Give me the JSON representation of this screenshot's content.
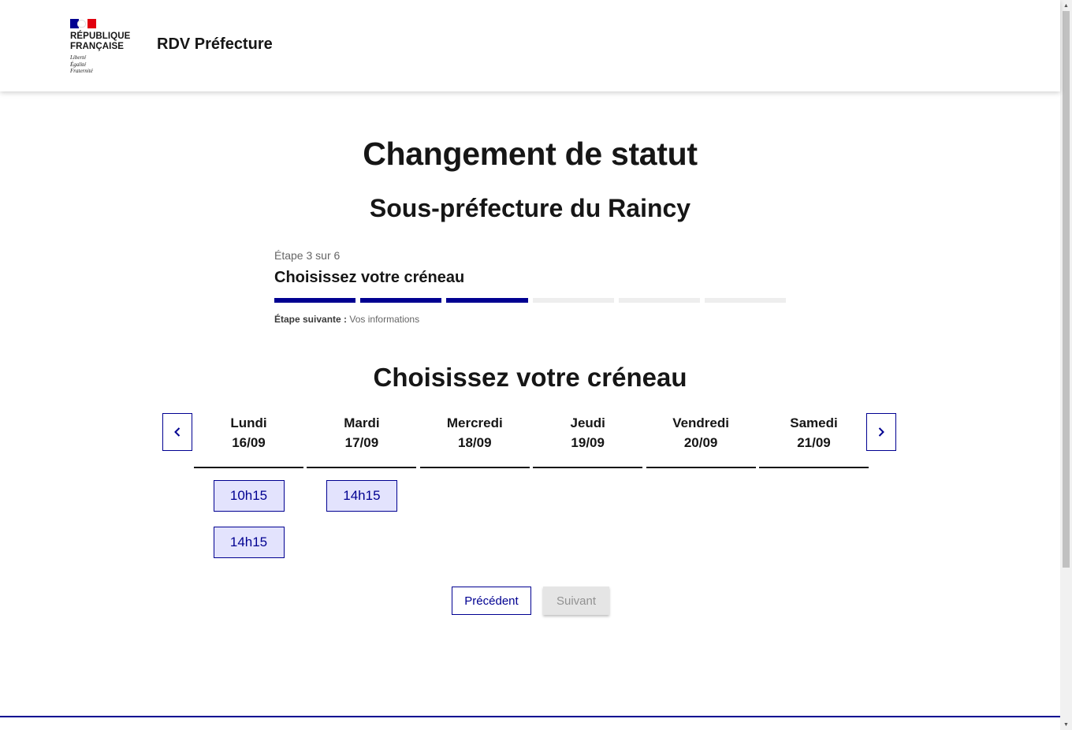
{
  "header": {
    "logo_title_line1": "République",
    "logo_title_line2": "Française",
    "motto_line1": "Liberté",
    "motto_line2": "Égalité",
    "motto_line3": "Fraternité",
    "service_title": "RDV Préfecture"
  },
  "main": {
    "title": "Changement de statut",
    "subtitle": "Sous-préfecture du Raincy",
    "stepper": {
      "state": "Étape 3 sur 6",
      "current_step": 3,
      "total_steps": 6,
      "title": "Choisissez votre créneau",
      "next_label": "Étape suivante :",
      "next_value": "Vos informations"
    },
    "section_title": "Choisissez votre créneau",
    "calendar": {
      "days": [
        {
          "name": "Lundi",
          "date": "16/09",
          "slots": [
            "10h15",
            "14h15"
          ]
        },
        {
          "name": "Mardi",
          "date": "17/09",
          "slots": [
            "14h15"
          ]
        },
        {
          "name": "Mercredi",
          "date": "18/09",
          "slots": []
        },
        {
          "name": "Jeudi",
          "date": "19/09",
          "slots": []
        },
        {
          "name": "Vendredi",
          "date": "20/09",
          "slots": []
        },
        {
          "name": "Samedi",
          "date": "21/09",
          "slots": []
        }
      ],
      "prev_icon": "chevron-left-icon",
      "next_icon": "chevron-right-icon"
    },
    "actions": {
      "previous_label": "Précédent",
      "next_label": "Suivant"
    }
  },
  "colors": {
    "primary": "#000091",
    "slot_background": "#e3e3fd",
    "disabled_background": "#e5e5e5",
    "disabled_text": "#929292"
  }
}
